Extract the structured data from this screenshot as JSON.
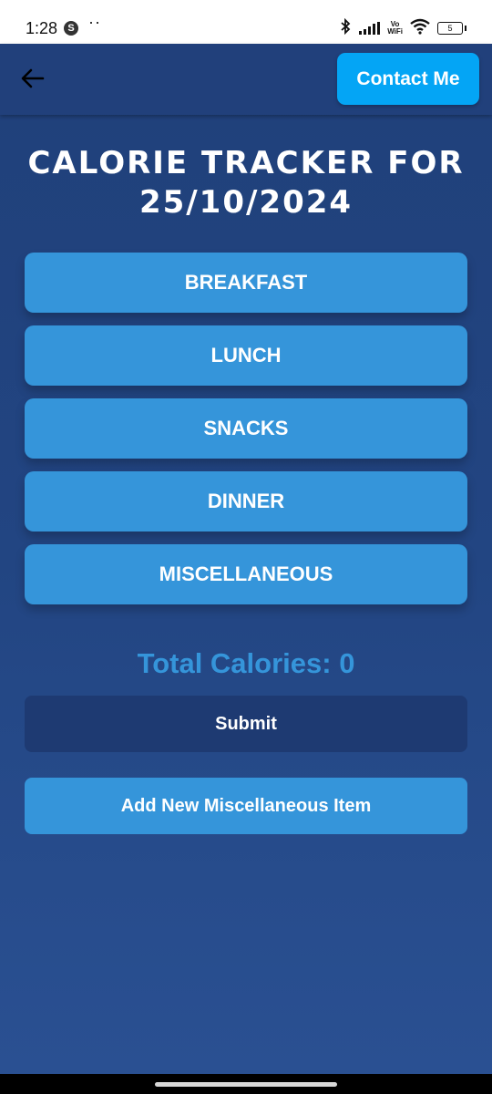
{
  "status_bar": {
    "time": "1:28",
    "notification_icon": "S",
    "dots": "··",
    "vowifi": [
      "Vo",
      "WiFi"
    ],
    "battery": "5"
  },
  "app_bar": {
    "back_icon": "arrow-left-icon",
    "contact_label": "Contact Me"
  },
  "title": "CALORIE TRACKER FOR 25/10/2024",
  "meals": [
    {
      "label": "BREAKFAST"
    },
    {
      "label": "LUNCH"
    },
    {
      "label": "SNACKS"
    },
    {
      "label": "DINNER"
    },
    {
      "label": "MISCELLANEOUS"
    }
  ],
  "total_calories": "Total Calories: 0",
  "submit_label": "Submit",
  "add_misc_label": "Add New Miscellaneous Item",
  "colors": {
    "background": "#224582",
    "app_bar": "#21407b",
    "accent_button": "#3595da",
    "contact_button": "#04a5f5",
    "submit_button": "#1e3a72",
    "total_text": "#3595da"
  }
}
